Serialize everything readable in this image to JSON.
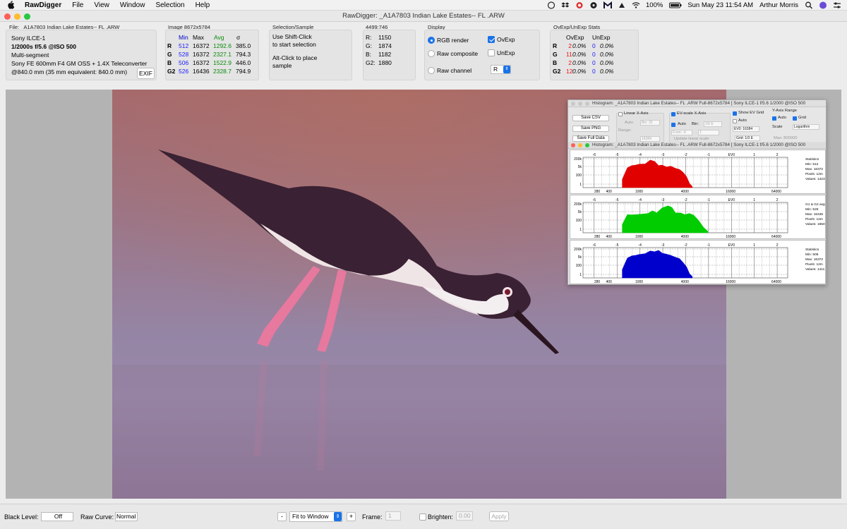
{
  "menubar": {
    "app": "RawDigger",
    "items": [
      "File",
      "View",
      "Window",
      "Selection",
      "Help"
    ],
    "battery": "100%",
    "datetime": "Sun May 23  11:54 AM",
    "user": "Arthur Morris"
  },
  "window": {
    "title": "RawDigger: _A1A7803  Indian Lake Estates-- FL .ARW"
  },
  "file_panel": {
    "title": "File: _A1A7803  Indian Lake Estates-- FL .ARW",
    "camera": "Sony ILCE-1",
    "exposure": "1/2000s f/5.6 @ISO 500",
    "metering": "Multi-segment",
    "lens": "Sony FE 600mm F4 GM OSS + 1.4X Teleconverter",
    "focal": "@840.0 mm (35 mm equivalent: 840.0 mm)",
    "exif_button": "EXIF"
  },
  "image_panel": {
    "title": "Image 8672x5784",
    "headers": [
      "Min",
      "Max",
      "Avg",
      "σ"
    ],
    "rows": [
      {
        "ch": "R",
        "min": "512",
        "max": "16372",
        "avg": "1292.6",
        "sd": "385.0"
      },
      {
        "ch": "G",
        "min": "528",
        "max": "16372",
        "avg": "2327.1",
        "sd": "794.3"
      },
      {
        "ch": "B",
        "min": "506",
        "max": "16372",
        "avg": "1522.9",
        "sd": "446.0"
      },
      {
        "ch": "G2",
        "min": "526",
        "max": "16436",
        "avg": "2328.7",
        "sd": "794.9"
      }
    ]
  },
  "selection_panel": {
    "title": "Selection/Sample",
    "line1": "Use Shift-Click",
    "line2": "to start selection",
    "line3": "Alt-Click to place",
    "line4": "sample"
  },
  "sample_panel": {
    "title": "4499:746",
    "rows": [
      {
        "k": "R:",
        "v": "1150"
      },
      {
        "k": "G:",
        "v": "1874"
      },
      {
        "k": "B:",
        "v": "1182"
      },
      {
        "k": "G2:",
        "v": "1880"
      }
    ]
  },
  "display_panel": {
    "title": "Display",
    "rgb_render": "RGB render",
    "raw_composite": "Raw composite",
    "raw_channel": "Raw channel",
    "ovexp": "OvExp",
    "unexp": "UnExp",
    "channel_value": "R",
    "rgb_selected": true,
    "ovexp_checked": true,
    "unexp_checked": false
  },
  "ovexp_panel": {
    "title": "OvExp/UnExp Stats",
    "headers": [
      "OvExp",
      "UnExp"
    ],
    "rows": [
      {
        "ch": "R",
        "ov": "2",
        "ovp": "0.0%",
        "un": "0",
        "unp": "0.0%"
      },
      {
        "ch": "G",
        "ov": "11",
        "ovp": "0.0%",
        "un": "0",
        "unp": "0.0%"
      },
      {
        "ch": "B",
        "ov": "2",
        "ovp": "0.0%",
        "un": "0",
        "unp": "0.0%"
      },
      {
        "ch": "G2",
        "ov": "12",
        "ovp": "0.0%",
        "un": "0",
        "unp": "0.0%"
      }
    ]
  },
  "histogram_window": {
    "title": "Histogram: _A1A7803  Indian Lake Estates-- FL .ARW Full-8672x5784 [ Sony ILCE-1 f/5.6 1/2000 @ISO 500",
    "save_csv": "Save CSV",
    "save_png": "Save PNG",
    "save_full": "Save Full Data",
    "linear_x": "Linear X-Axis",
    "auto": "Auto",
    "bin": "Bin:",
    "range": "Range:",
    "ev_scale": "EV-scale X-Axis",
    "update_linear": "Update linear scale",
    "show_ev_grid": "Show EV Grid",
    "ev0": "EV0: 16384",
    "grid": "Grid: 1/3 E",
    "y_axis_range": "Y-Axis Range",
    "grid_label": "Grid",
    "scale": "Scale",
    "scale_value": "Logarithm",
    "max_value": "Max: 800000",
    "bin_val_1": "Bin: 32",
    "bin_val_2": "1/6 E",
    "range_val": "16384",
    "from_val": "From: -6",
    "to_val": "1",
    "ev_ticks": [
      "-6",
      "-5",
      "-4",
      "-3",
      "-2",
      "-1",
      "EV0",
      "1",
      "2"
    ],
    "x_ticks": [
      "280",
      "400",
      "1000",
      "4000",
      "16000",
      "64000"
    ],
    "y_ticks": [
      "200k",
      "5k",
      "100",
      "1"
    ],
    "panes": [
      {
        "color": "#e00000",
        "lines": [
          "Statistics",
          "Min: 512",
          "Max: 16372",
          "Pixels: 12m",
          "Values: 1423"
        ]
      },
      {
        "color": "#00cc00",
        "lines": [
          "G1 & G2 avg",
          "Min: 526",
          "Max: 16436",
          "Pixels: 12m",
          "Values: 1650"
        ]
      },
      {
        "color": "#0000cc",
        "lines": [
          "Statistics",
          "Min: 506",
          "Max: 16372",
          "Pixels: 12m",
          "Values: 1411"
        ]
      }
    ]
  },
  "chart_data": [
    {
      "type": "area",
      "series": [
        {
          "name": "",
          "color": "#e00000",
          "x": [
            600,
            700,
            800,
            900,
            1000,
            1200,
            1400,
            1600,
            1800,
            2000,
            2300,
            2600,
            3000,
            3400,
            3800,
            4200,
            4600,
            5000
          ],
          "values": [
            0.3,
            0.72,
            0.8,
            0.82,
            0.85,
            0.86,
            1,
            0.95,
            0.8,
            0.82,
            0.75,
            0.78,
            0.7,
            0.66,
            0.55,
            0.4,
            0.15,
            0.04
          ]
        }
      ],
      "xlim": [
        280,
        64000
      ]
    },
    {
      "type": "area",
      "series": [
        {
          "name": "",
          "color": "#00cc00",
          "x": [
            600,
            700,
            800,
            900,
            1000,
            1300,
            1500,
            1700,
            2000,
            2400,
            2700,
            3000,
            3500,
            4000,
            4600,
            5200,
            6000,
            7000,
            8000
          ],
          "values": [
            0.3,
            0.66,
            0.65,
            0.66,
            0.67,
            0.7,
            0.8,
            0.72,
            0.9,
            0.98,
            0.92,
            0.72,
            0.72,
            0.66,
            0.7,
            0.64,
            0.46,
            0.2,
            0.05
          ]
        }
      ],
      "xlim": [
        280,
        64000
      ]
    },
    {
      "type": "area",
      "series": [
        {
          "name": "",
          "color": "#0000cc",
          "x": [
            600,
            700,
            800,
            900,
            1000,
            1200,
            1400,
            1600,
            1800,
            2000,
            2300,
            2600,
            3000,
            3400,
            3800,
            4200,
            4600,
            5000
          ],
          "values": [
            0.3,
            0.72,
            0.8,
            0.82,
            0.85,
            0.88,
            0.98,
            0.95,
            1,
            0.9,
            0.86,
            0.82,
            0.75,
            0.7,
            0.55,
            0.4,
            0.15,
            0.05
          ]
        }
      ],
      "xlim": [
        280,
        64000
      ]
    }
  ],
  "bottom": {
    "black_level_label": "Black Level:",
    "black_level_value": "Off",
    "raw_curve_label": "Raw Curve:",
    "raw_curve_value": "Normal",
    "minus": "-",
    "plus": "+",
    "zoom": "Fit to Window",
    "frame_label": "Frame:",
    "frame_value": "1",
    "brighten_label": "Brighten:",
    "brighten_value": "0.00",
    "apply": "Apply"
  },
  "colors": {
    "accent": "#1a73e8",
    "close": "#ff5f57",
    "minimize": "#febc2e",
    "zoom": "#28c840"
  }
}
